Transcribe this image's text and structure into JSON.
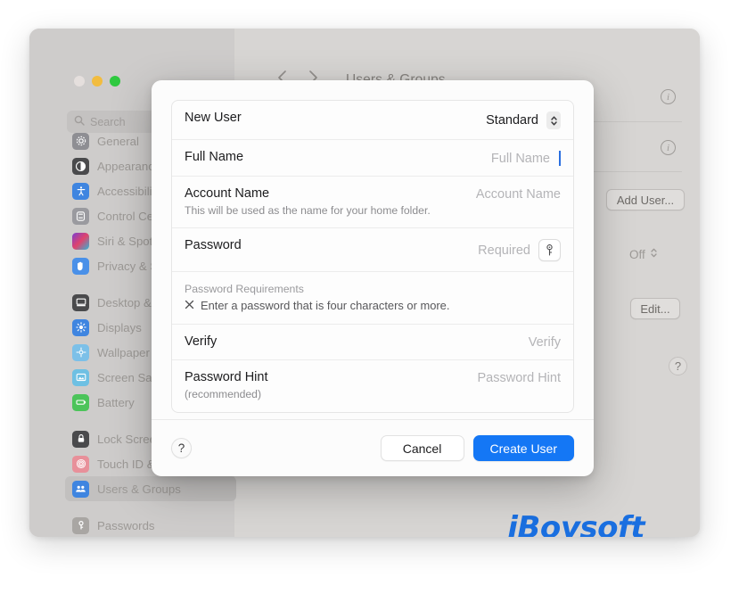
{
  "window": {
    "title": "Users & Groups",
    "back_icon": "chevron-left-icon",
    "forward_icon": "chevron-right-icon",
    "traffic_lights": [
      "close",
      "minimize",
      "zoom"
    ]
  },
  "search": {
    "placeholder": "Search",
    "value": "",
    "icon": "search-icon"
  },
  "sidebar": {
    "groups": [
      {
        "items": [
          {
            "label": "General",
            "icon": "gear-icon",
            "color": "#8e8e93",
            "selected": false
          },
          {
            "label": "Appearance",
            "icon": "appearance-icon",
            "color": "#4a4a4c",
            "selected": false
          },
          {
            "label": "Accessibility",
            "icon": "accessibility-icon",
            "color": "#3f85e0",
            "selected": false
          },
          {
            "label": "Control Center",
            "icon": "control-center-icon",
            "color": "#9a9a9f",
            "selected": false
          },
          {
            "label": "Siri & Spotlight",
            "icon": "siri-icon",
            "color": "#c7538f",
            "selected": false
          },
          {
            "label": "Privacy & Security",
            "icon": "privacy-icon",
            "color": "#4a90e8",
            "selected": false
          }
        ]
      },
      {
        "items": [
          {
            "label": "Desktop & Dock",
            "icon": "desktop-dock-icon",
            "color": "#4a4a4c",
            "selected": false
          },
          {
            "label": "Displays",
            "icon": "displays-icon",
            "color": "#3f85e0",
            "selected": false
          },
          {
            "label": "Wallpaper",
            "icon": "wallpaper-icon",
            "color": "#7cc0e8",
            "selected": false
          },
          {
            "label": "Screen Saver",
            "icon": "screen-saver-icon",
            "color": "#6ec0e3",
            "selected": false
          },
          {
            "label": "Battery",
            "icon": "battery-icon",
            "color": "#4cc45a",
            "selected": false
          }
        ]
      },
      {
        "items": [
          {
            "label": "Lock Screen",
            "icon": "lock-screen-icon",
            "color": "#4a4a4c",
            "selected": false
          },
          {
            "label": "Touch ID & Password",
            "icon": "touch-id-icon",
            "color": "#e8909a",
            "selected": false
          },
          {
            "label": "Users & Groups",
            "icon": "users-groups-icon",
            "color": "#3f85e0",
            "selected": true
          }
        ]
      },
      {
        "items": [
          {
            "label": "Passwords",
            "icon": "passwords-key-icon",
            "color": "#a9a6a3",
            "selected": false
          }
        ]
      }
    ]
  },
  "content_pane": {
    "info_icon": "info-icon",
    "add_user_button": "Add User...",
    "off_popup_value": "Off",
    "off_popup_icon": "chevron-updown-icon",
    "edit_button": "Edit...",
    "help_button": "?"
  },
  "sheet": {
    "rows": {
      "new_user": {
        "label": "New User",
        "value": "Standard",
        "stepper_icon": "chevron-updown-icon"
      },
      "full_name": {
        "label": "Full Name",
        "placeholder": "Full Name",
        "value": "",
        "focused": true
      },
      "account_name": {
        "label": "Account Name",
        "sublabel": "This will be used as the name for your home folder.",
        "placeholder": "Account Name",
        "value": ""
      },
      "password": {
        "label": "Password",
        "placeholder": "Required",
        "value": "",
        "key_icon": "key-icon"
      },
      "requirements": {
        "title": "Password Requirements",
        "status_icon": "x-mark-icon",
        "text": "Enter a password that is four characters or more."
      },
      "verify": {
        "label": "Verify",
        "placeholder": "Verify",
        "value": ""
      },
      "password_hint": {
        "label": "Password Hint",
        "sublabel": "(recommended)",
        "placeholder": "Password Hint",
        "value": ""
      }
    },
    "footer": {
      "help_label": "?",
      "cancel_label": "Cancel",
      "create_label": "Create User",
      "primary_color": "#1477f5"
    }
  },
  "watermark": {
    "text": "iBoysoft",
    "color": "#1a6fe0"
  }
}
